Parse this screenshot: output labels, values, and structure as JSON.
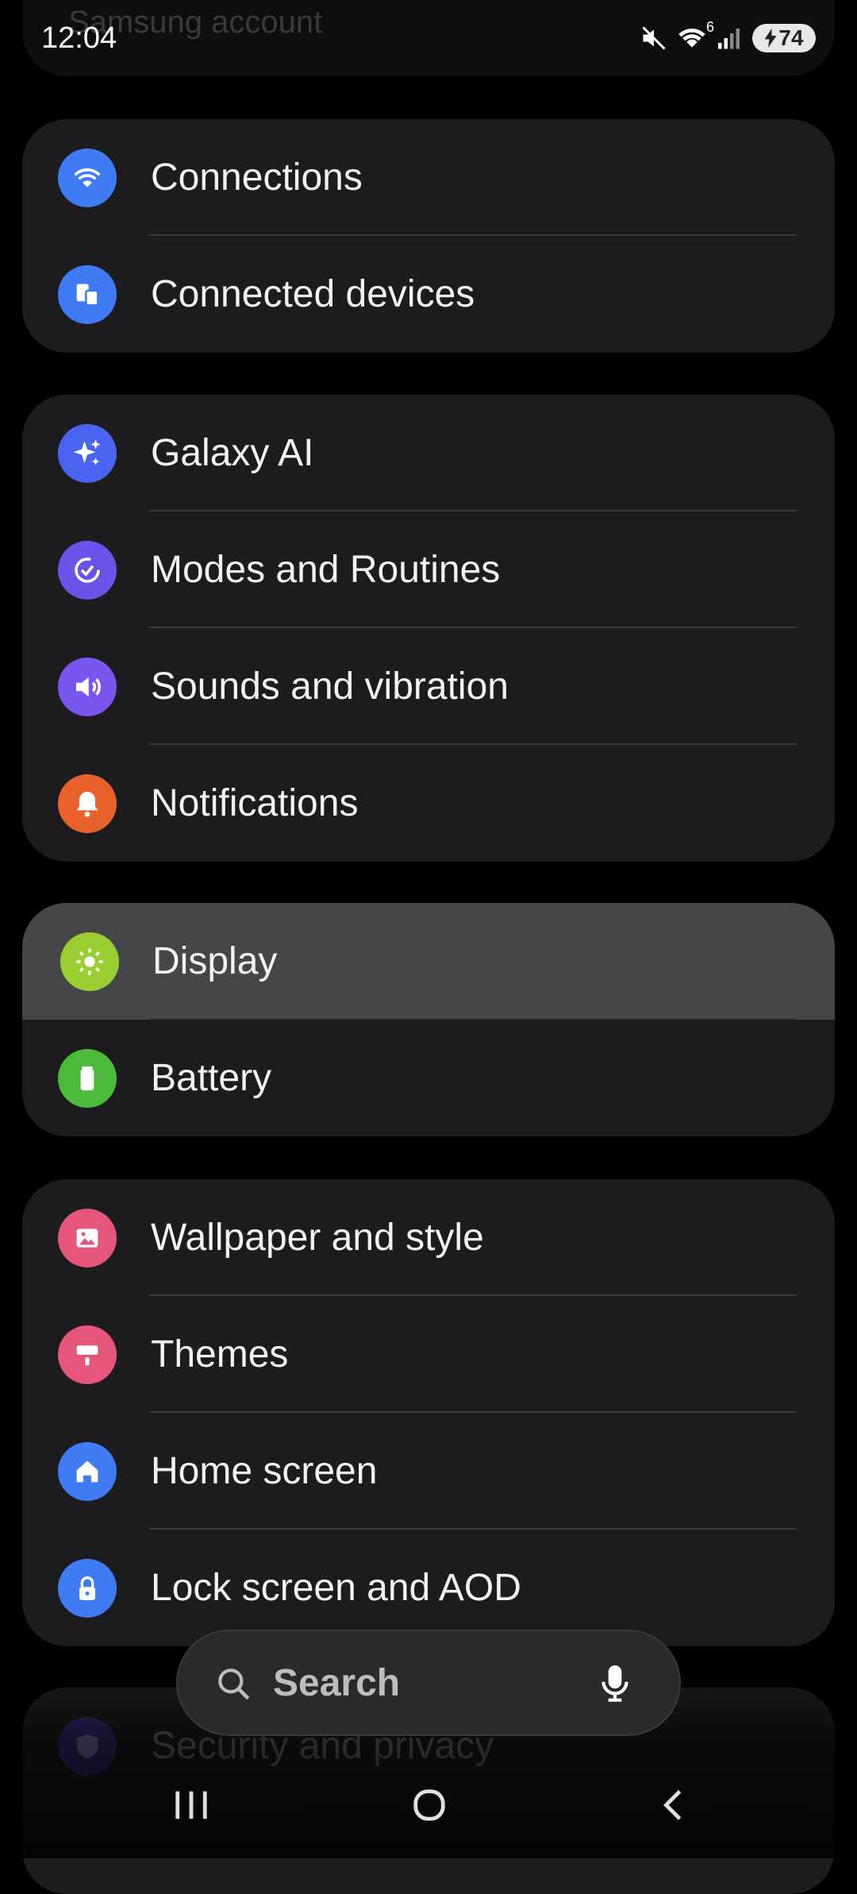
{
  "status_bar": {
    "time": "12:04",
    "battery_level": "74",
    "wifi_label": "6"
  },
  "header": {
    "partial_title": "Samsung account"
  },
  "groups": [
    {
      "items": [
        {
          "label": "Connections",
          "icon": "wifi-icon",
          "color": "#3e7bf5"
        },
        {
          "label": "Connected devices",
          "icon": "devices-icon",
          "color": "#3e7bf5"
        }
      ]
    },
    {
      "items": [
        {
          "label": "Galaxy AI",
          "icon": "sparkle-icon",
          "color": "#4a63f0"
        },
        {
          "label": "Modes and Routines",
          "icon": "check-circle-icon",
          "color": "#6d52ea"
        },
        {
          "label": "Sounds and vibration",
          "icon": "speaker-icon",
          "color": "#7a56f0"
        },
        {
          "label": "Notifications",
          "icon": "bell-icon",
          "color": "#e9612a"
        }
      ]
    },
    {
      "items": [
        {
          "label": "Display",
          "icon": "sun-icon",
          "color": "#9acd32",
          "highlighted": true
        },
        {
          "label": "Battery",
          "icon": "battery-icon",
          "color": "#4cbb3c"
        }
      ]
    },
    {
      "items": [
        {
          "label": "Wallpaper and style",
          "icon": "image-icon",
          "color": "#e5567a"
        },
        {
          "label": "Themes",
          "icon": "paintbrush-icon",
          "color": "#e5567a"
        },
        {
          "label": "Home screen",
          "icon": "home-icon",
          "color": "#3e7bf5"
        },
        {
          "label": "Lock screen and AOD",
          "icon": "lock-icon",
          "color": "#3e7bf5"
        }
      ]
    },
    {
      "items": [
        {
          "label": "Security and privacy",
          "icon": "shield-icon",
          "color": "#4a3aa0"
        }
      ]
    }
  ],
  "search": {
    "placeholder": "Search"
  }
}
